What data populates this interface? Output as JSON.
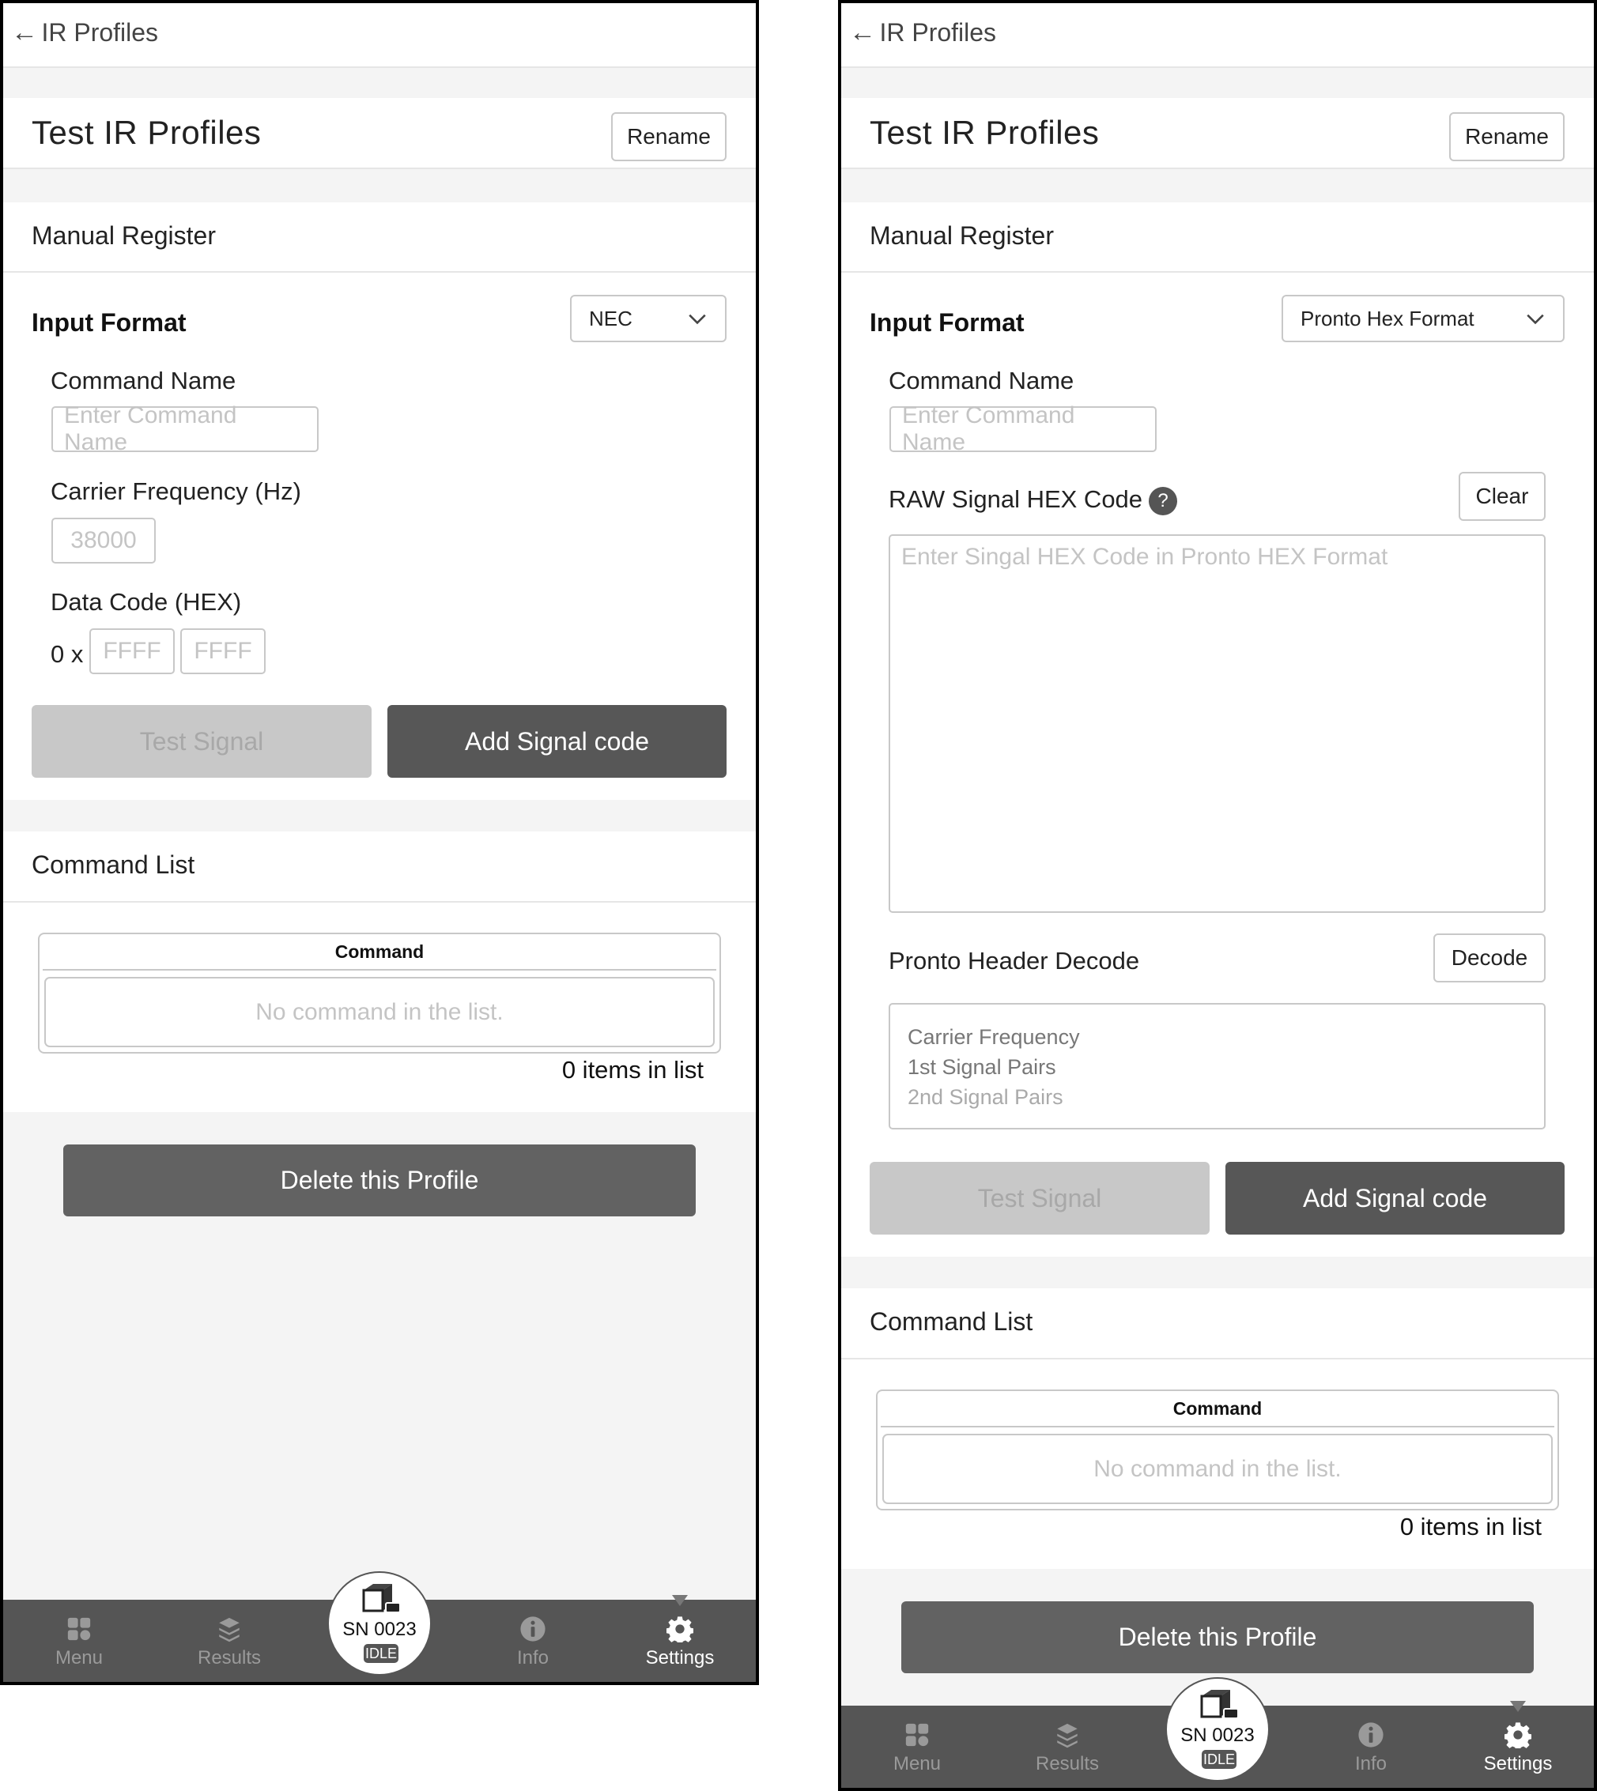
{
  "screens": [
    {
      "id": "nec",
      "header": {
        "back_label": "IR Profiles"
      },
      "profile": {
        "title": "Test IR Profiles",
        "rename_label": "Rename"
      },
      "manual_register": {
        "section_title": "Manual Register",
        "input_format_label": "Input Format",
        "input_format_value": "NEC",
        "command_name_label": "Command Name",
        "command_name_placeholder": "Enter Command Name",
        "carrier_label": "Carrier Frequency (Hz)",
        "carrier_placeholder": "38000",
        "data_code_label": "Data Code (HEX)",
        "data_code_prefix": "0 x",
        "data_code_placeholder_1": "FFFF",
        "data_code_placeholder_2": "FFFF",
        "test_signal_label": "Test Signal",
        "add_signal_label": "Add Signal code"
      },
      "command_list": {
        "section_title": "Command List",
        "column_header": "Command",
        "empty_text": "No command in the list.",
        "count_text": "0 items in list"
      },
      "delete_label": "Delete this Profile"
    },
    {
      "id": "pronto",
      "header": {
        "back_label": "IR Profiles"
      },
      "profile": {
        "title": "Test IR Profiles",
        "rename_label": "Rename"
      },
      "manual_register": {
        "section_title": "Manual Register",
        "input_format_label": "Input Format",
        "input_format_value": "Pronto Hex Format",
        "command_name_label": "Command Name",
        "command_name_placeholder": "Enter Command Name",
        "raw_hex_label": "RAW Signal HEX Code",
        "help_glyph": "?",
        "clear_label": "Clear",
        "raw_hex_placeholder": "Enter Singal HEX Code in Pronto HEX Format",
        "pronto_header_label": "Pronto Header Decode",
        "decode_label": "Decode",
        "decode_lines": [
          "Carrier Frequency",
          "1st Signal Pairs",
          "2nd Signal Pairs"
        ],
        "test_signal_label": "Test Signal",
        "add_signal_label": "Add Signal code"
      },
      "command_list": {
        "section_title": "Command List",
        "column_header": "Command",
        "empty_text": "No command in the list.",
        "count_text": "0 items in list"
      },
      "delete_label": "Delete this Profile"
    }
  ],
  "bottom_nav": {
    "items": [
      {
        "label": "Menu",
        "icon": "grid-icon",
        "active": false
      },
      {
        "label": "Results",
        "icon": "layers-icon",
        "active": false
      },
      {
        "label": "Info",
        "icon": "info-icon",
        "active": false
      },
      {
        "label": "Settings",
        "icon": "gear-icon",
        "active": true
      }
    ],
    "device": {
      "serial": "SN 0023",
      "status": "IDLE"
    }
  },
  "colors": {
    "primary_button": "#575757",
    "delete_button": "#626262",
    "disabled_button": "#c8c8c8",
    "nav_background": "#555555",
    "page_background": "#f4f4f4"
  }
}
